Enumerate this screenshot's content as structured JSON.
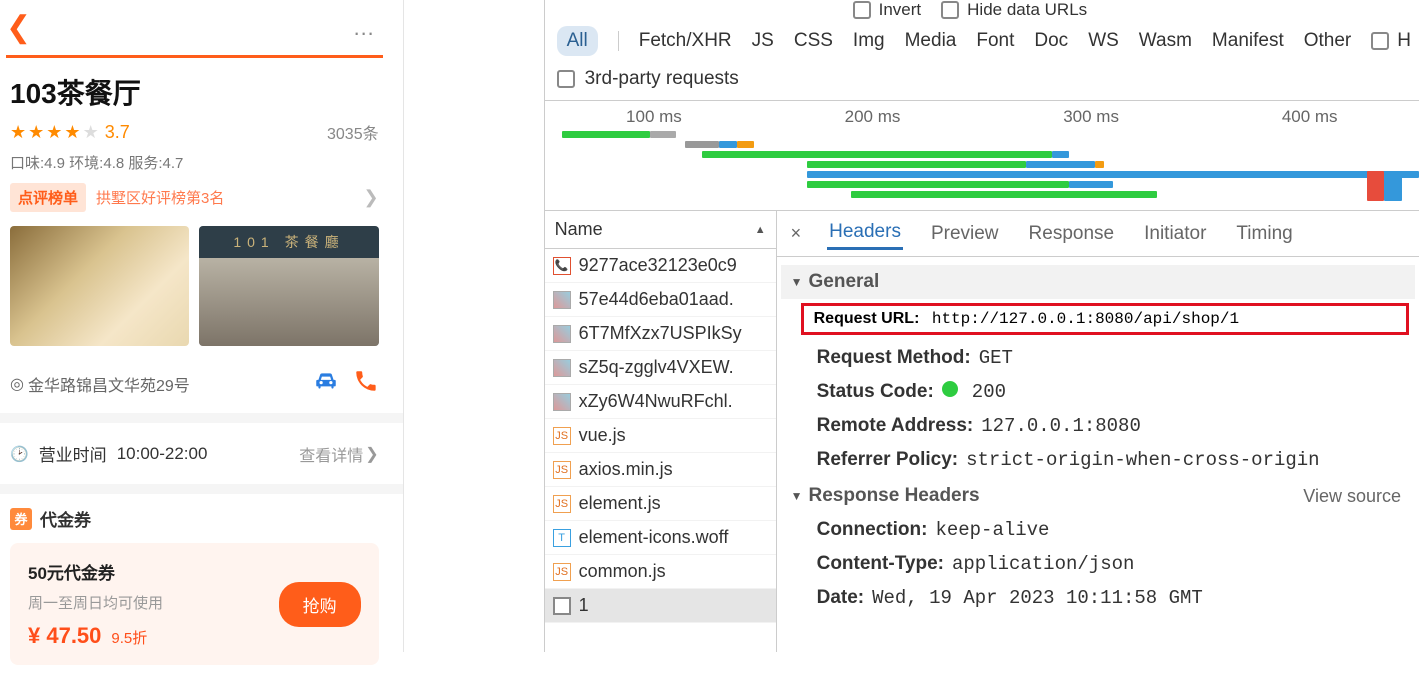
{
  "mobile": {
    "shop_name": "103茶餐厅",
    "rating": "3.7",
    "review_count": "3035条",
    "metrics": "口味:4.9 环境:4.8 服务:4.7",
    "rank_badge": "点评榜单",
    "rank_text": "拱墅区好评榜第3名",
    "storefront_sign": "101 茶餐廳",
    "address": "金华路锦昌文华苑29号",
    "hours_label": "营业时间",
    "hours_value": "10:00-22:00",
    "detail_link": "查看详情",
    "voucher_section_title": "代金券",
    "voucher_badge": "券",
    "voucher": {
      "title": "50元代金券",
      "subtitle": "周一至周日均可使用",
      "price": "¥ 47.50",
      "discount": "9.5折",
      "buy": "抢购"
    }
  },
  "devtools": {
    "filter_invert": "Invert",
    "filter_hide": "Hide data URLs",
    "types": [
      "All",
      "Fetch/XHR",
      "JS",
      "CSS",
      "Img",
      "Media",
      "Font",
      "Doc",
      "WS",
      "Wasm",
      "Manifest",
      "Other"
    ],
    "third_party": "3rd-party requests",
    "truncated_h": "H",
    "timeline_labels": [
      "100 ms",
      "200 ms",
      "300 ms",
      "400 ms"
    ],
    "name_header": "Name",
    "requests": [
      {
        "icon": "red",
        "label": "9277ace32123e0c9"
      },
      {
        "icon": "img",
        "label": "57e44d6eba01aad."
      },
      {
        "icon": "img",
        "label": "6T7MfXzx7USPIkSy"
      },
      {
        "icon": "img",
        "label": "sZ5q-zgglv4VXEW."
      },
      {
        "icon": "img",
        "label": "xZy6W4NwuRFchl."
      },
      {
        "icon": "js",
        "label": "vue.js"
      },
      {
        "icon": "js",
        "label": "axios.min.js"
      },
      {
        "icon": "js",
        "label": "element.js"
      },
      {
        "icon": "font",
        "label": "element-icons.woff"
      },
      {
        "icon": "js",
        "label": "common.js"
      },
      {
        "icon": "doc",
        "label": "1"
      }
    ],
    "tabs": [
      "Headers",
      "Preview",
      "Response",
      "Initiator",
      "Timing"
    ],
    "close_x": "×",
    "general_label": "General",
    "request_url_label": "Request URL:",
    "request_url_value": "http://127.0.0.1:8080/api/shop/1",
    "request_method_label": "Request Method:",
    "request_method_value": "GET",
    "status_code_label": "Status Code:",
    "status_code_value": "200",
    "remote_addr_label": "Remote Address:",
    "remote_addr_value": "127.0.0.1:8080",
    "referrer_label": "Referrer Policy:",
    "referrer_value": "strict-origin-when-cross-origin",
    "response_headers_label": "Response Headers",
    "view_source": "View source",
    "connection_label": "Connection:",
    "connection_value": "keep-alive",
    "content_type_label": "Content-Type:",
    "content_type_value": "application/json",
    "date_label": "Date:",
    "date_value": "Wed, 19 Apr 2023 10:11:58 GMT"
  }
}
